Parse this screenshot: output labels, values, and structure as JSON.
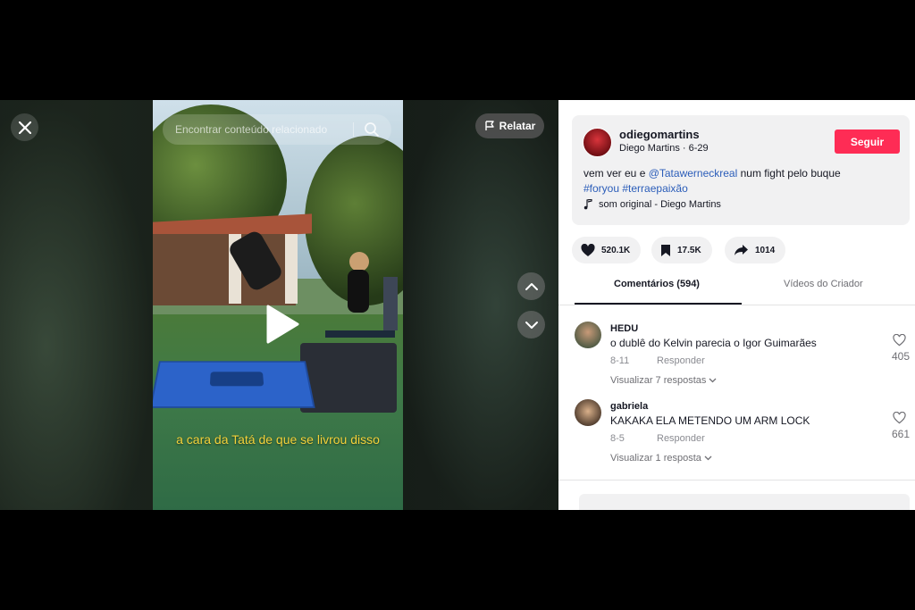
{
  "video": {
    "search_placeholder": "Encontrar conteúdo relacionado",
    "caption": "a cara da Tatá de que se livrou disso",
    "report_label": "Relatar"
  },
  "post": {
    "username": "odiegomartins",
    "display_name": "Diego Martins",
    "date": "6-29",
    "follow_label": "Seguir",
    "desc_prefix": "vem ver eu e ",
    "mention": "@Tatawerneckreal",
    "desc_suffix": " num fight pelo buque",
    "hashtag1": "#foryou",
    "hashtag2": "#terraepaixão",
    "sound": "som original - Diego Martins"
  },
  "actions": {
    "likes": "520.1K",
    "saves": "17.5K",
    "shares": "1014"
  },
  "tabs": {
    "comments": "Comentários (594)",
    "creator_videos": "Vídeos do Criador"
  },
  "comments": [
    {
      "name": "HEDU",
      "text": "o dublê do Kelvin parecia o Igor Guimarães",
      "date": "8-11",
      "reply": "Responder",
      "more": "Visualizar 7 respostas",
      "likes": "405"
    },
    {
      "name": "gabriela",
      "text": "KAKAKA ELA METENDO UM ARM LOCK",
      "date": "8-5",
      "reply": "Responder",
      "more": "Visualizar 1 resposta",
      "likes": "661"
    }
  ],
  "colors": {
    "accent": "#fe2c55",
    "link": "#2b5db9",
    "caption": "#f3d23a"
  }
}
